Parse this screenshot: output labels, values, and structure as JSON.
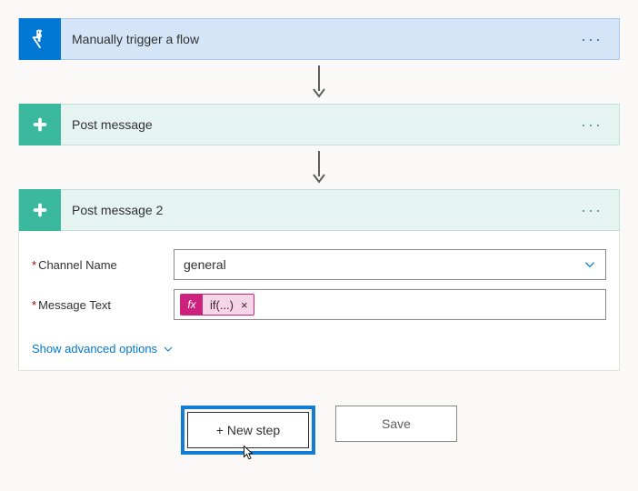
{
  "trigger": {
    "title": "Manually trigger a flow"
  },
  "action1": {
    "title": "Post message"
  },
  "action2": {
    "title": "Post message 2",
    "fields": {
      "channel": {
        "label": "Channel Name",
        "value": "general"
      },
      "message": {
        "label": "Message Text",
        "token_fx": "fx",
        "token_label": "if(...)"
      }
    },
    "advanced_label": "Show advanced options"
  },
  "buttons": {
    "new_step": "+ New step",
    "save": "Save"
  }
}
